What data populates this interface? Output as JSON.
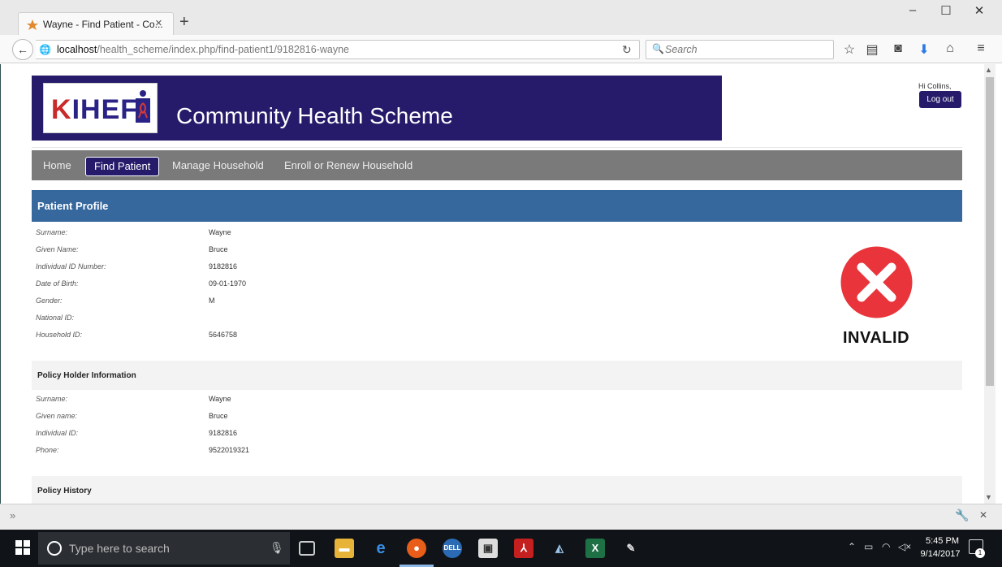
{
  "browser": {
    "tab_title": "Wayne - Find Patient - Co...",
    "url_host": "localhost",
    "url_path": "/health_scheme/index.php/find-patient1/9182816-wayne",
    "search_placeholder": "Search"
  },
  "site": {
    "logo_text": "IHEF",
    "logo_k": "K",
    "title": "Community Health Scheme",
    "greeting": "Hi Collins,",
    "logout_label": "Log out"
  },
  "menu": [
    {
      "label": "Home",
      "active": false
    },
    {
      "label": "Find Patient",
      "active": true
    },
    {
      "label": "Manage Household",
      "active": false
    },
    {
      "label": "Enroll or Renew Household",
      "active": false
    }
  ],
  "profile": {
    "title": "Patient Profile",
    "rows": [
      {
        "label": "Surname:",
        "value": "Wayne"
      },
      {
        "label": "Given Name:",
        "value": "Bruce"
      },
      {
        "label": "Individual ID Number:",
        "value": "9182816"
      },
      {
        "label": "Date of Birth:",
        "value": "09-01-1970"
      },
      {
        "label": "Gender:",
        "value": "M"
      },
      {
        "label": "National ID:",
        "value": ""
      },
      {
        "label": "Household ID:",
        "value": "5646758"
      }
    ],
    "status": {
      "text": "INVALID",
      "color": "#e8343a"
    }
  },
  "policy_holder": {
    "title": "Policy Holder Information",
    "rows": [
      {
        "label": "Surname:",
        "value": "Wayne"
      },
      {
        "label": "Given name:",
        "value": "Bruce"
      },
      {
        "label": "Individual ID:",
        "value": "9182816"
      },
      {
        "label": "Phone:",
        "value": "9522019321"
      }
    ]
  },
  "policy_history": {
    "title": "Policy History"
  },
  "taskbar": {
    "search_placeholder": "Type here to search",
    "time": "5:45 PM",
    "date": "9/14/2017",
    "notifications": "1"
  },
  "colors": {
    "header_bg": "#251b6a",
    "section_bg": "#36689e",
    "menu_bg": "#7a7a7a"
  }
}
